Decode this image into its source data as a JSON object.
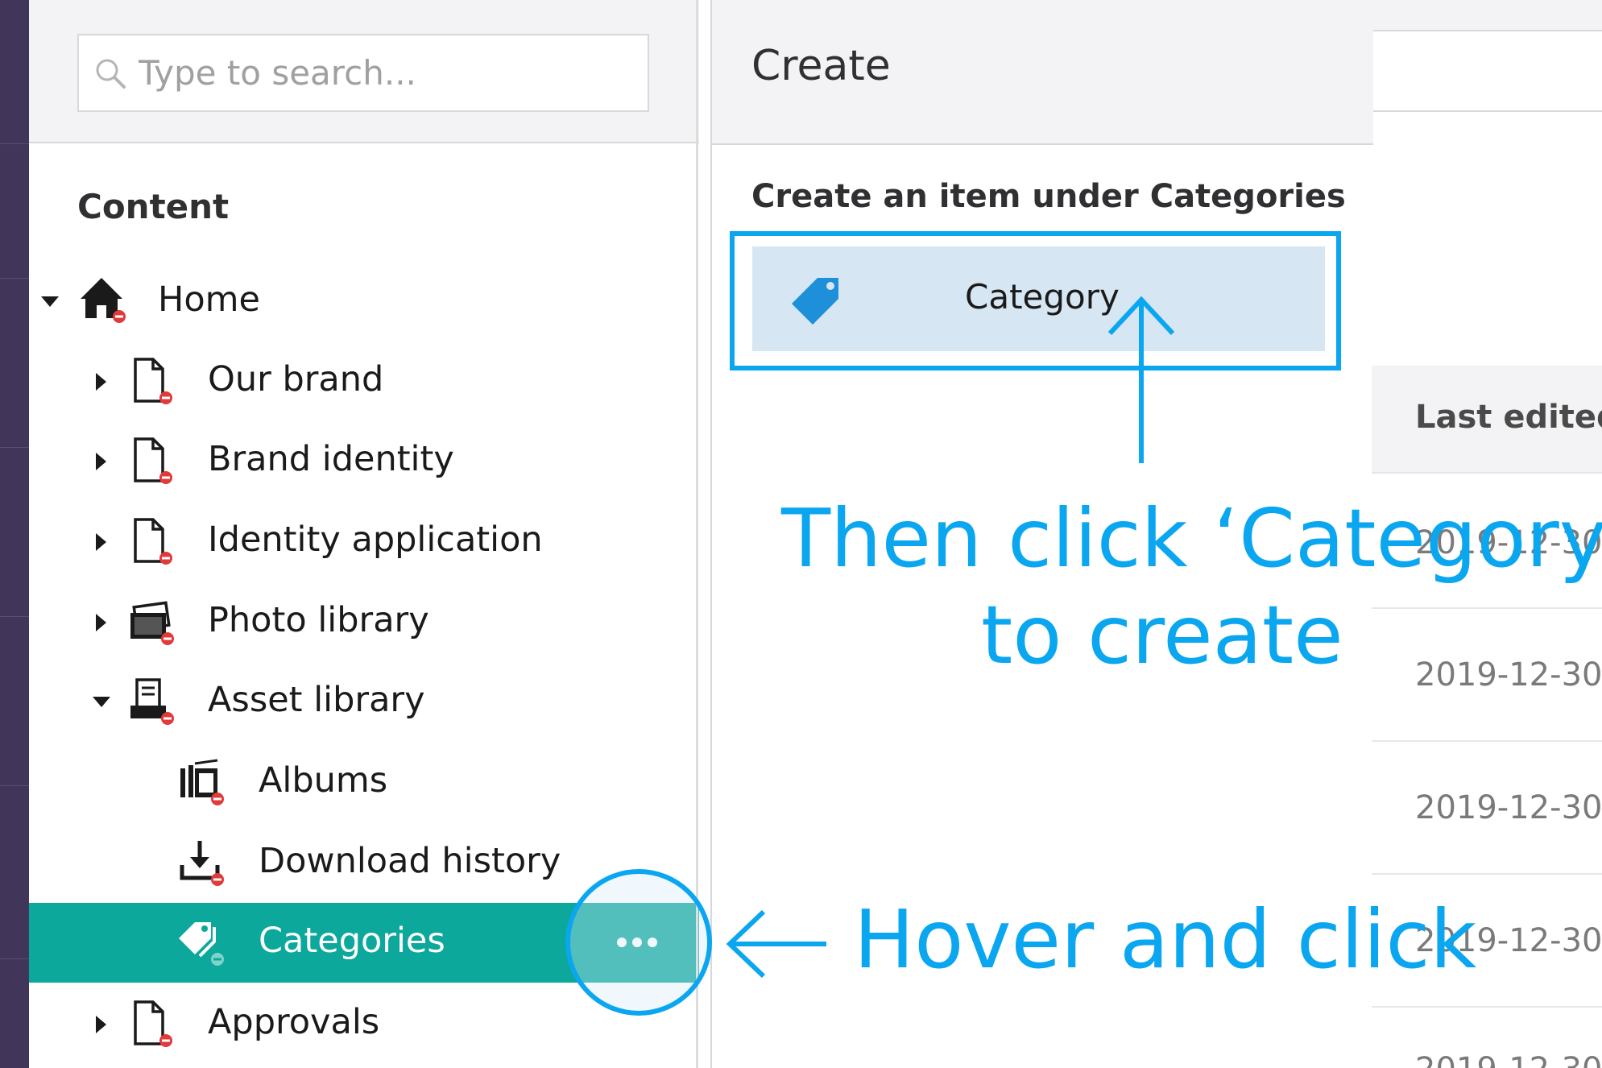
{
  "search": {
    "placeholder": "Type to search..."
  },
  "tree": {
    "section_title": "Content",
    "items": [
      {
        "label": "Home",
        "icon": "home-icon",
        "expanded": true
      },
      {
        "label": "Our brand",
        "icon": "document-icon",
        "expanded": false
      },
      {
        "label": "Brand identity",
        "icon": "document-icon",
        "expanded": false
      },
      {
        "label": "Identity application",
        "icon": "document-icon",
        "expanded": false
      },
      {
        "label": "Photo library",
        "icon": "photos-icon",
        "expanded": false
      },
      {
        "label": "Asset library",
        "icon": "archive-icon",
        "expanded": true
      },
      {
        "label": "Albums",
        "icon": "albums-icon"
      },
      {
        "label": "Download history",
        "icon": "download-icon"
      },
      {
        "label": "Categories",
        "icon": "tags-icon",
        "selected": true
      },
      {
        "label": "Approvals",
        "icon": "document-icon",
        "expanded": false
      }
    ]
  },
  "create_panel": {
    "title": "Create",
    "subtitle": "Create an item under Categories",
    "items": [
      {
        "label": "Category",
        "icon": "tag-icon"
      }
    ]
  },
  "list_view": {
    "column_header": "Last edited",
    "dates": [
      "2019-12-30",
      "2019-12-30",
      "2019-12-30",
      "2019-12-30",
      "2019-12-30"
    ]
  },
  "annotations": {
    "then_click_line1": "Then click ‘Category’",
    "then_click_line2": "to create",
    "hover_and_click": "Hover and click"
  },
  "colors": {
    "selected_row": "#0ba89b",
    "annotation": "#0aa6f0",
    "create_item_bg": "#d6e6f3",
    "nav_rail": "#413659",
    "unpublished_badge": "#e03a3a"
  }
}
